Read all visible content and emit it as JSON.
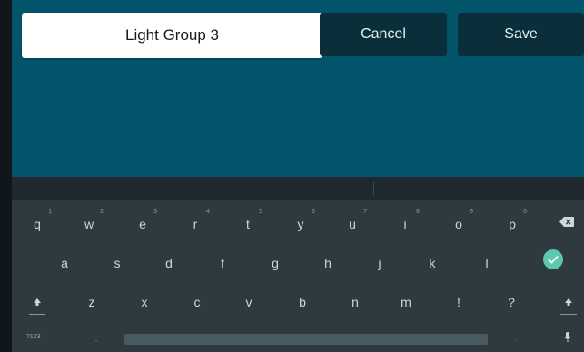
{
  "header": {
    "name_value": "Light Group 3",
    "cancel_label": "Cancel",
    "save_label": "Save"
  },
  "keyboard": {
    "row1": [
      "q",
      "w",
      "e",
      "r",
      "t",
      "y",
      "u",
      "i",
      "o",
      "p"
    ],
    "row1_hints": [
      "1",
      "2",
      "3",
      "4",
      "5",
      "6",
      "7",
      "8",
      "9",
      "0"
    ],
    "row2": [
      "a",
      "s",
      "d",
      "f",
      "g",
      "h",
      "j",
      "k",
      "l"
    ],
    "row3": [
      "z",
      "x",
      "c",
      "v",
      "b",
      "n",
      "m",
      "!",
      "?"
    ],
    "symbols_label": "?123",
    "icons": {
      "backspace": "backspace-icon",
      "enter": "checkmark-icon",
      "shift": "shift-icon",
      "mic": "mic-icon"
    }
  },
  "colors": {
    "header_bg": "#02546b",
    "button_bg": "#0a2f3a",
    "keyboard_bg": "#2e3a40",
    "enter_accent": "#5ec7b0"
  }
}
